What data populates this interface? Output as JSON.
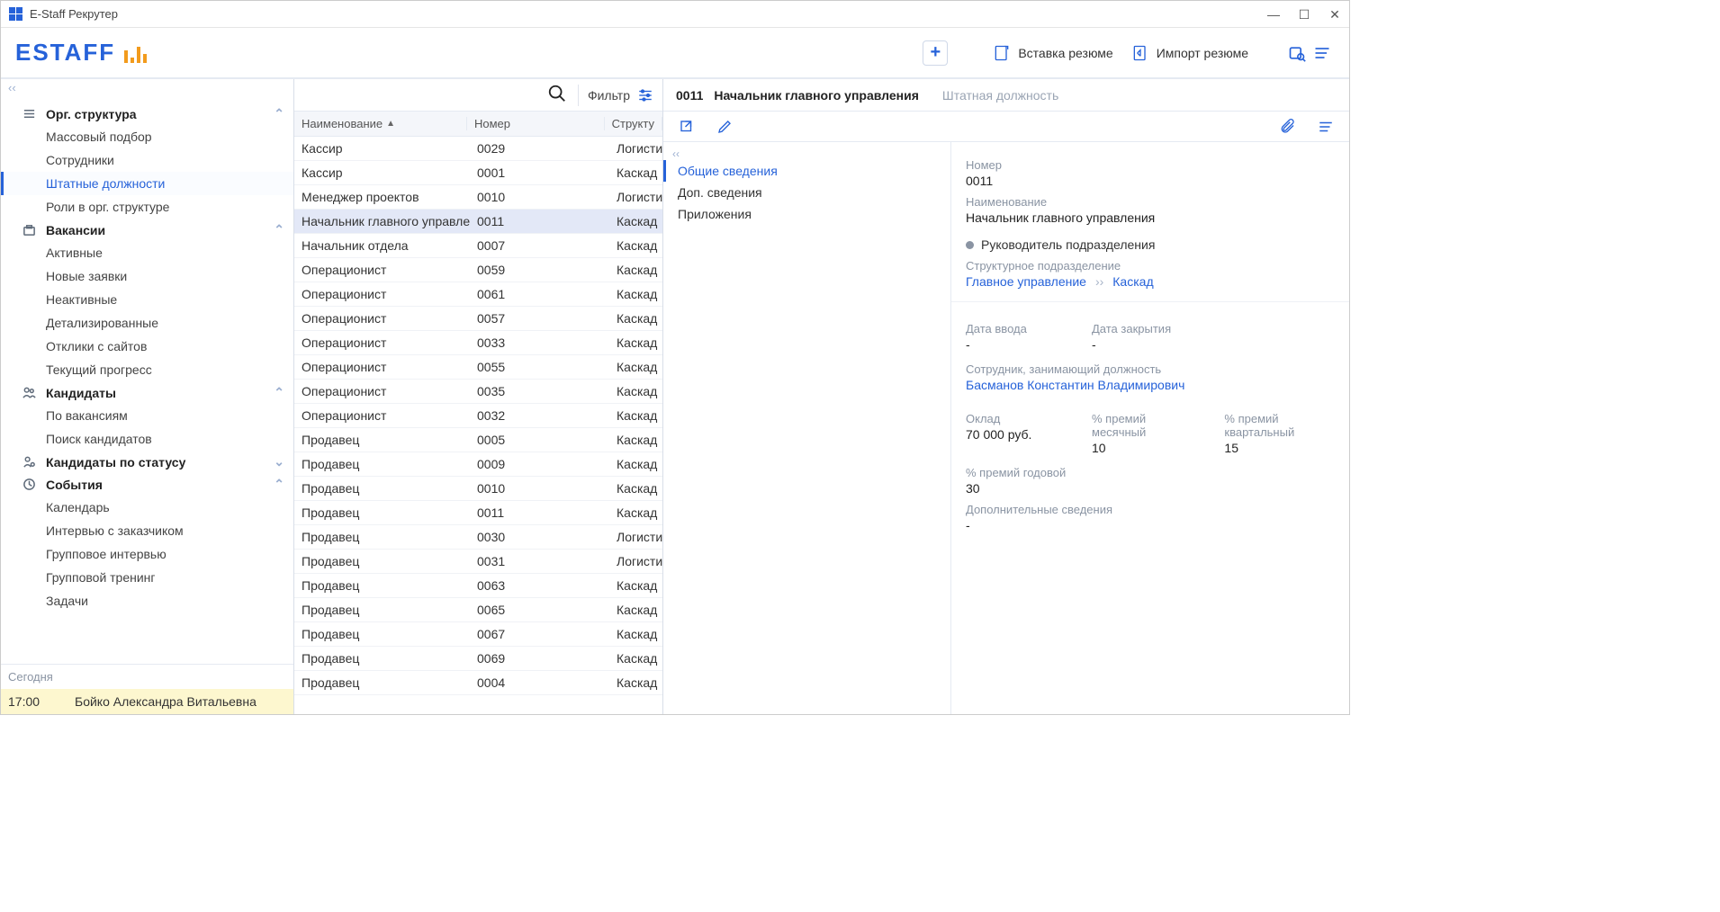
{
  "window": {
    "title": "E-Staff Рекрутер"
  },
  "logo": {
    "text": "ESTAFF"
  },
  "toolbar": {
    "insert_resume": "Вставка резюме",
    "import_resume": "Импорт резюме"
  },
  "sidebar": {
    "collapse_glyph": "‹‹",
    "groups": {
      "org": {
        "title": "Орг. структура",
        "items": [
          "Массовый подбор",
          "Сотрудники",
          "Штатные должности",
          "Роли в орг. структуре"
        ],
        "active_index": 2
      },
      "vacancies": {
        "title": "Вакансии",
        "items": [
          "Активные",
          "Новые заявки",
          "Неактивные",
          "Детализированные",
          "Отклики с сайтов",
          "Текущий прогресс"
        ]
      },
      "candidates": {
        "title": "Кандидаты",
        "items": [
          "По вакансиям",
          "Поиск кандидатов"
        ]
      },
      "candidates_status": {
        "title": "Кандидаты по статусу"
      },
      "events": {
        "title": "События",
        "items": [
          "Календарь",
          "Интервью с заказчиком",
          "Групповое интервью",
          "Групповой тренинг",
          "Задачи"
        ]
      }
    },
    "today": {
      "label": "Сегодня",
      "event": {
        "time": "17:00",
        "person": "Бойко Александра Витальевна"
      }
    }
  },
  "list": {
    "filter_label": "Фильтр",
    "columns": {
      "name": "Наименование",
      "number": "Номер",
      "struct": "Структу"
    },
    "rows": [
      {
        "name": "Кассир",
        "num": "0029",
        "struct": "Логисти"
      },
      {
        "name": "Кассир",
        "num": "0001",
        "struct": "Каскад"
      },
      {
        "name": "Менеджер проектов",
        "num": "0010",
        "struct": "Логисти"
      },
      {
        "name": "Начальник главного управле",
        "num": "0011",
        "struct": "Каскад"
      },
      {
        "name": "Начальник отдела",
        "num": "0007",
        "struct": "Каскад"
      },
      {
        "name": "Операционист",
        "num": "0059",
        "struct": "Каскад"
      },
      {
        "name": "Операционист",
        "num": "0061",
        "struct": "Каскад"
      },
      {
        "name": "Операционист",
        "num": "0057",
        "struct": "Каскад"
      },
      {
        "name": "Операционист",
        "num": "0033",
        "struct": "Каскад"
      },
      {
        "name": "Операционист",
        "num": "0055",
        "struct": "Каскад"
      },
      {
        "name": "Операционист",
        "num": "0035",
        "struct": "Каскад"
      },
      {
        "name": "Операционист",
        "num": "0032",
        "struct": "Каскад"
      },
      {
        "name": "Продавец",
        "num": "0005",
        "struct": "Каскад"
      },
      {
        "name": "Продавец",
        "num": "0009",
        "struct": "Каскад"
      },
      {
        "name": "Продавец",
        "num": "0010",
        "struct": "Каскад"
      },
      {
        "name": "Продавец",
        "num": "0011",
        "struct": "Каскад"
      },
      {
        "name": "Продавец",
        "num": "0030",
        "struct": "Логисти"
      },
      {
        "name": "Продавец",
        "num": "0031",
        "struct": "Логисти"
      },
      {
        "name": "Продавец",
        "num": "0063",
        "struct": "Каскад"
      },
      {
        "name": "Продавец",
        "num": "0065",
        "struct": "Каскад"
      },
      {
        "name": "Продавец",
        "num": "0067",
        "struct": "Каскад"
      },
      {
        "name": "Продавец",
        "num": "0069",
        "struct": "Каскад"
      },
      {
        "name": "Продавец",
        "num": "0004",
        "struct": "Каскад"
      }
    ],
    "selected_index": 3
  },
  "detail": {
    "code": "0011",
    "title": "Начальник главного управления",
    "subtitle": "Штатная должность",
    "tabs": [
      "Общие сведения",
      "Доп. сведения",
      "Приложения"
    ],
    "active_tab": 0,
    "labels": {
      "number": "Номер",
      "name": "Наименование",
      "head": "Руководитель подразделения",
      "struct": "Структурное подразделение",
      "date_in": "Дата ввода",
      "date_close": "Дата закрытия",
      "employee": "Сотрудник, занимающий должность",
      "salary": "Оклад",
      "bonus_month": "% премий месячный",
      "bonus_quarter": "% премий квартальный",
      "bonus_year": "% премий годовой",
      "extra": "Дополнительные сведения"
    },
    "values": {
      "number": "0011",
      "name": "Начальник главного управления",
      "struct_main": "Главное управление",
      "struct_sep": "››",
      "struct_company": "Каскад",
      "date_in": "-",
      "date_close": "-",
      "employee": "Басманов Константин Владимирович",
      "salary": "70 000 руб.",
      "bonus_month": "10",
      "bonus_quarter": "15",
      "bonus_year": "30",
      "extra": "-"
    }
  }
}
